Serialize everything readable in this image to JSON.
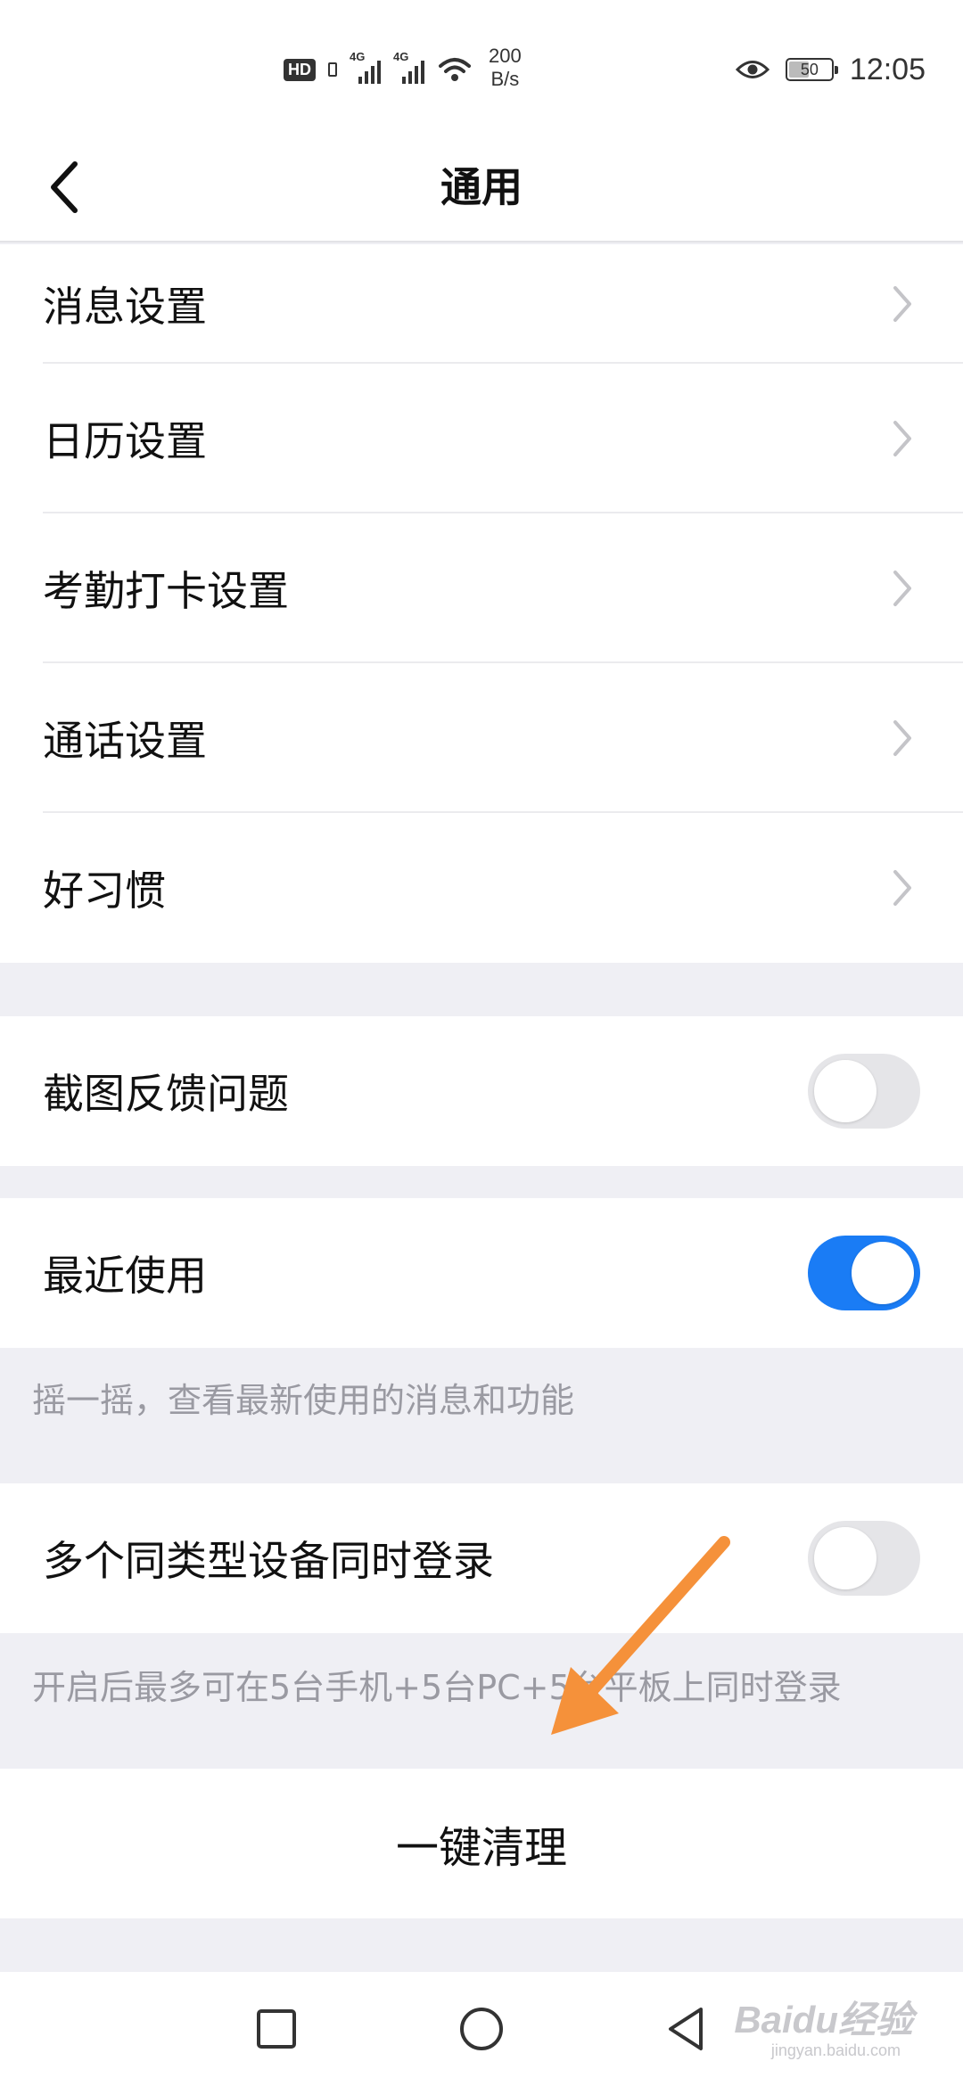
{
  "status_bar": {
    "hd_label": "HD",
    "signal1_label": "4G",
    "signal2_label": "4G",
    "net_speed_value": "200",
    "net_speed_unit": "B/s",
    "battery_level": "50",
    "time": "12:05"
  },
  "header": {
    "title": "通用"
  },
  "settings_group": {
    "items": [
      {
        "label": "消息设置"
      },
      {
        "label": "日历设置"
      },
      {
        "label": "考勤打卡设置"
      },
      {
        "label": "通话设置"
      },
      {
        "label": "好习惯"
      }
    ]
  },
  "screenshot_feedback": {
    "label": "截图反馈问题",
    "enabled": false
  },
  "recent_use": {
    "label": "最近使用",
    "enabled": true,
    "hint": "摇一摇，查看最新使用的消息和功能"
  },
  "multi_device": {
    "label": "多个同类型设备同时登录",
    "enabled": false,
    "hint": "开启后最多可在5台手机+5台PC+5台平板上同时登录"
  },
  "clean_button": {
    "label": "一键清理"
  },
  "colors": {
    "toggle_on": "#1a7cf5",
    "toggle_off": "#e5e5e8",
    "annotation_arrow": "#f5913a",
    "background": "#efeff4"
  },
  "icons": {
    "back": "back-arrow-icon",
    "chevron": "chevron-right-icon",
    "recent_apps": "square-icon",
    "home": "circle-icon",
    "back_nav": "triangle-back-icon"
  },
  "watermark": {
    "text": "Baidu经验",
    "sub": "jingyan.baidu.com"
  }
}
